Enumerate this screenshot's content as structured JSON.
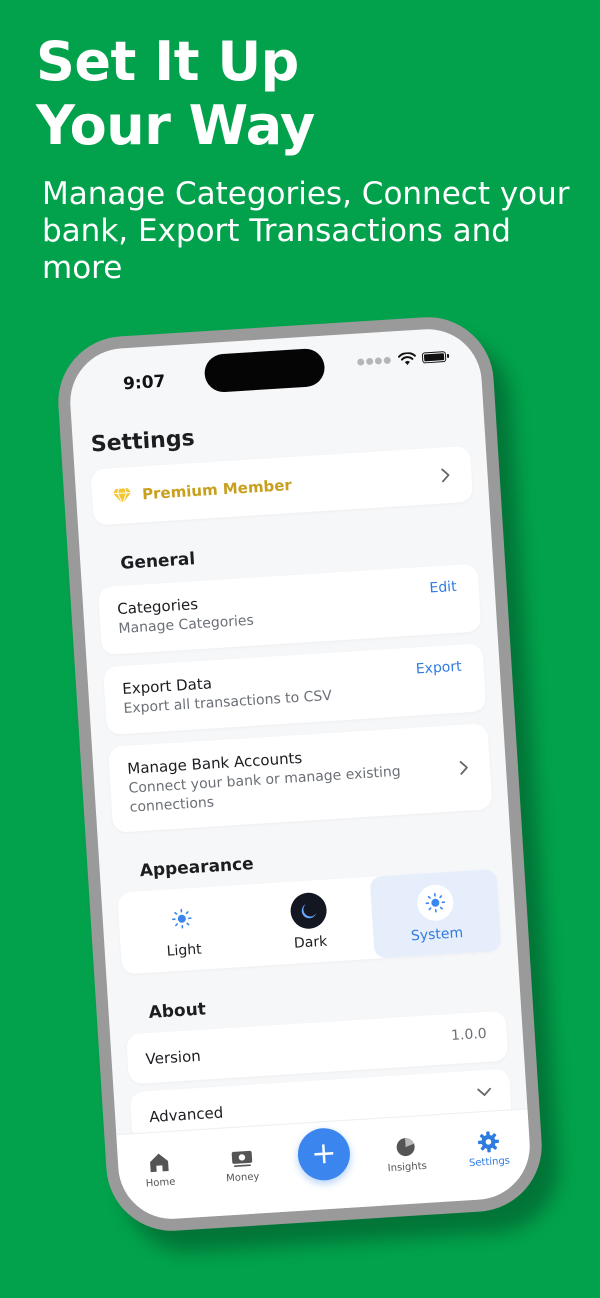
{
  "promo": {
    "headline": "Set It Up\nYour Way",
    "subheadline": "Manage Categories, Connect your bank, Export Transactions and more"
  },
  "status_bar": {
    "time": "9:07"
  },
  "settings": {
    "title": "Settings",
    "premium_label": "Premium Member",
    "general": {
      "title": "General",
      "categories": {
        "title": "Categories",
        "subtitle": "Manage Categories",
        "action": "Edit"
      },
      "export": {
        "title": "Export Data",
        "subtitle": "Export all transactions to CSV",
        "action": "Export"
      },
      "bank": {
        "title": "Manage Bank Accounts",
        "subtitle": "Connect your bank or manage existing connections"
      }
    },
    "appearance": {
      "title": "Appearance",
      "modes": [
        {
          "label": "Light",
          "icon": "sun-icon"
        },
        {
          "label": "Dark",
          "icon": "moon-icon"
        },
        {
          "label": "System",
          "icon": "system-sun-icon"
        }
      ],
      "selected": "System"
    },
    "about": {
      "title": "About",
      "version_label": "Version",
      "version_value": "1.0.0",
      "advanced_label": "Advanced"
    }
  },
  "tabbar": {
    "items": [
      {
        "label": "Home",
        "icon": "home-icon"
      },
      {
        "label": "Money",
        "icon": "money-icon"
      },
      {
        "label": "+",
        "icon": "plus-icon"
      },
      {
        "label": "Insights",
        "icon": "pie-chart-icon"
      },
      {
        "label": "Settings",
        "icon": "gear-icon"
      }
    ],
    "active": "Settings"
  },
  "colors": {
    "background": "#02a24c",
    "accent": "#2f7ce0",
    "premium_gold": "#c8a01e",
    "fab": "#3a86ee"
  }
}
